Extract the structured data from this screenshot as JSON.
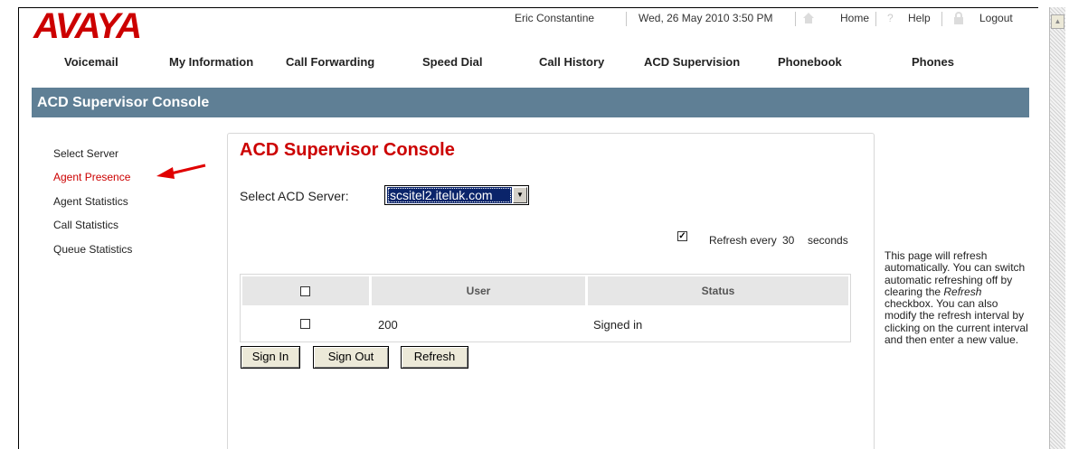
{
  "header": {
    "logo": "AVAYA",
    "user_name": "Eric Constantine",
    "datetime": "Wed, 26 May 2010 3:50 PM",
    "home_label": "Home",
    "help_label": "Help",
    "logout_label": "Logout"
  },
  "nav": [
    "Voicemail",
    "My Information",
    "Call Forwarding",
    "Speed Dial",
    "Call History",
    "ACD Supervision",
    "Phonebook",
    "Phones"
  ],
  "banner_title": "ACD Supervisor Console",
  "sidebar": [
    {
      "label": "Select Server",
      "active": false
    },
    {
      "label": "Agent Presence",
      "active": true
    },
    {
      "label": "Agent Statistics",
      "active": false
    },
    {
      "label": "Call Statistics",
      "active": false
    },
    {
      "label": "Queue Statistics",
      "active": false
    }
  ],
  "main": {
    "title": "ACD Supervisor Console",
    "server_label": "Select ACD Server:",
    "server_value": "scsitel2.iteluk.com",
    "refresh_checked": true,
    "refresh_prefix": "Refresh every",
    "refresh_interval": "30",
    "refresh_suffix": "seconds",
    "table": {
      "headers": [
        "",
        "User",
        "Status"
      ],
      "rows": [
        {
          "checked": false,
          "user": "200",
          "status": "Signed in"
        }
      ]
    },
    "buttons": {
      "sign_in": "Sign In",
      "sign_out": "Sign Out",
      "refresh": "Refresh"
    }
  },
  "help": {
    "part1": "This page will refresh automatically. You can switch automatic refreshing off by clearing the ",
    "emphasis": "Refresh",
    "part2": " checkbox. You can also modify the refresh interval by clicking on the current interval and then enter a new value."
  },
  "colors": {
    "brand_red": "#cc0000",
    "banner_bg": "#5f7f95"
  }
}
